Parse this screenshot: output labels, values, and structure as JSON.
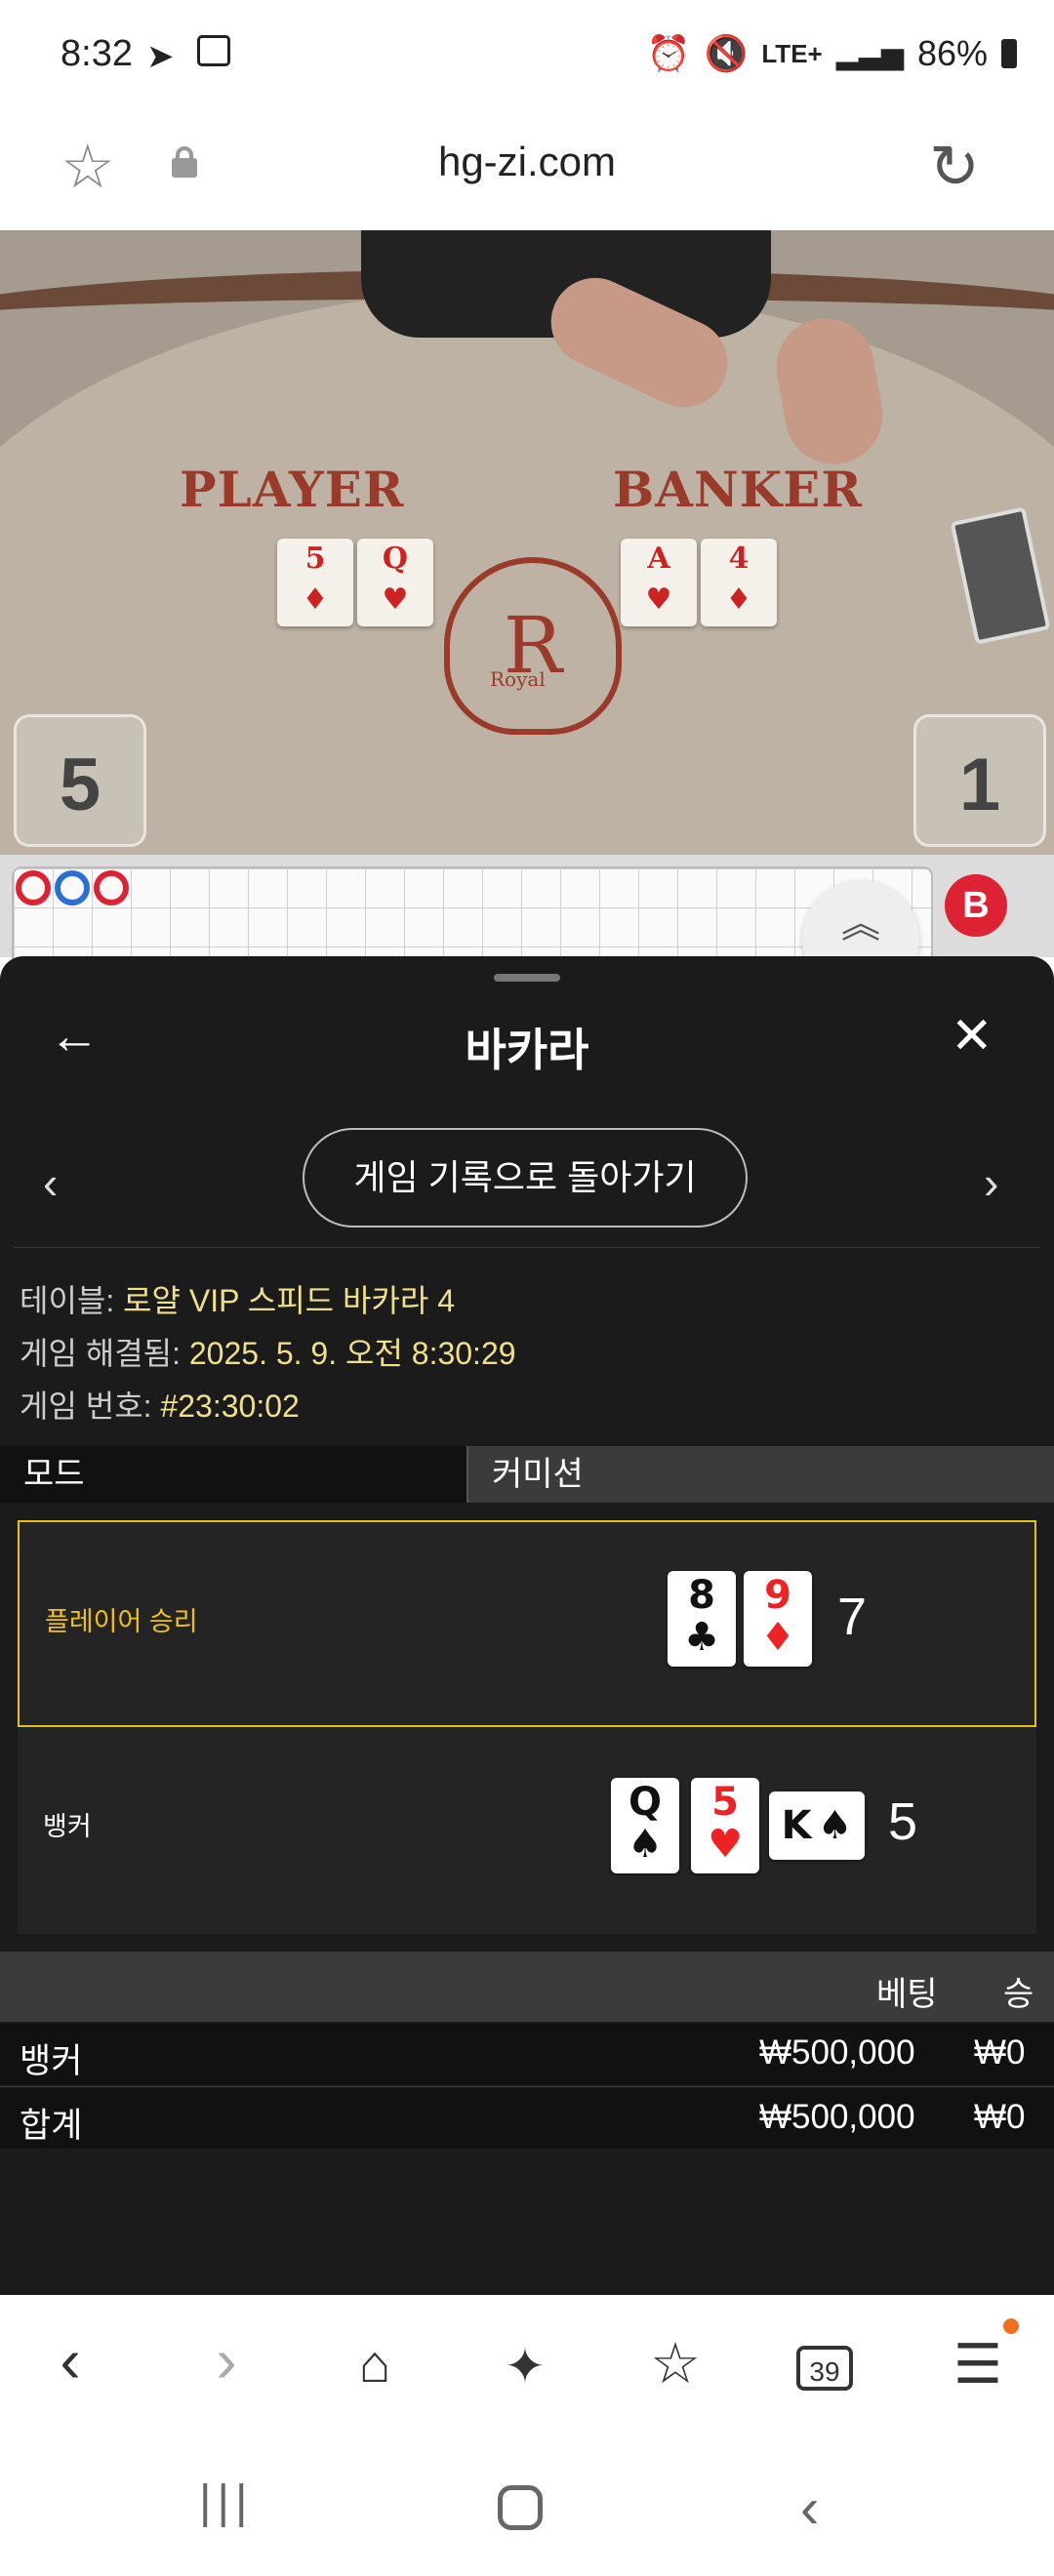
{
  "status_bar": {
    "time": "8:32",
    "network": "LTE+",
    "battery": "86%",
    "icons": [
      "telegram-icon",
      "gallery-icon",
      "alarm-icon",
      "mute-icon",
      "signal-icon",
      "battery-icon"
    ]
  },
  "browser": {
    "url": "hg-zi.com",
    "icons": [
      "bookmark-star-icon",
      "lock-icon",
      "reload-icon"
    ]
  },
  "video": {
    "player_label": "PLAYER",
    "banker_label": "BANKER",
    "player_cards": [
      {
        "rank": "5",
        "suit": "♦"
      },
      {
        "rank": "Q",
        "suit": "♥"
      }
    ],
    "banker_cards": [
      {
        "rank": "A",
        "suit": "♥"
      },
      {
        "rank": "4",
        "suit": "♦"
      }
    ],
    "crest_letter": "R",
    "crest_text": "Royal",
    "player_score": "5",
    "banker_score": "1"
  },
  "roadmap": {
    "badge": "B"
  },
  "panel": {
    "title": "바카라",
    "back_button": "게임 기록으로 돌아가기",
    "table_label": "테이블:",
    "table_value": "로얄 VIP 스피드 바카라 4",
    "resolved_label": "게임 해결됨:",
    "resolved_value": "2025. 5. 9. 오전 8:30:29",
    "game_no_label": "게임 번호:",
    "game_no_value": "#23:30:02",
    "tab_mode": "모드",
    "tab_commission": "커미션",
    "hands": [
      {
        "label": "플레이어 승리",
        "total": "7",
        "cards": [
          {
            "rank": "8",
            "suit": "♣",
            "color": "black"
          },
          {
            "rank": "9",
            "suit": "♦",
            "color": "red"
          }
        ]
      },
      {
        "label": "뱅커",
        "total": "5",
        "cards": [
          {
            "rank": "Q",
            "suit": "♠",
            "color": "black"
          },
          {
            "rank": "5",
            "suit": "♥",
            "color": "red"
          },
          {
            "rank": "K",
            "suit": "♠",
            "color": "black"
          }
        ]
      }
    ],
    "bet_header": {
      "bet": "베팅",
      "win": "승"
    },
    "bet_rows": [
      {
        "name": "뱅커",
        "bet": "₩500,000",
        "win": "₩0"
      },
      {
        "name": "합계",
        "bet": "₩500,000",
        "win": "₩0"
      }
    ]
  },
  "toolbar": {
    "tab_count": "39",
    "icons": [
      "back-icon",
      "forward-icon",
      "home-icon",
      "ai-sparkle-icon",
      "bookmarks-icon",
      "tabs-icon",
      "menu-icon"
    ]
  },
  "colors": {
    "panel_bg": "#1b1b1b",
    "winner_border": "#e2c020",
    "info_value": "#f0e08a"
  }
}
